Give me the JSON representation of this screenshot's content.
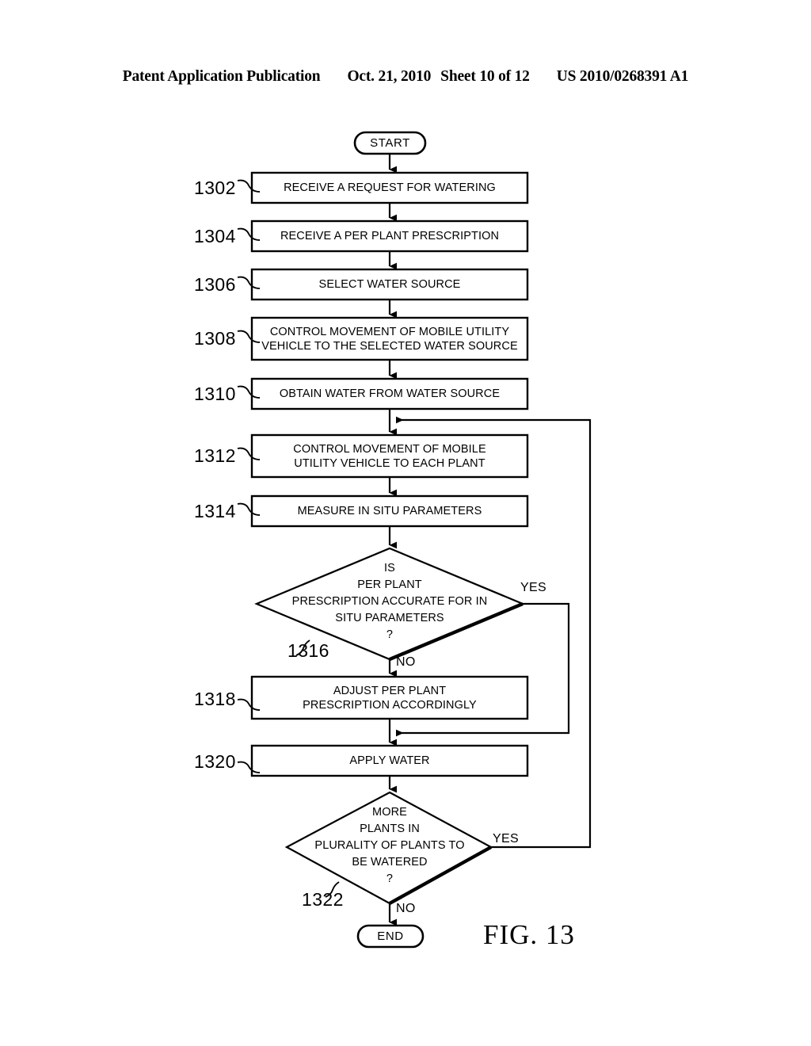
{
  "header": {
    "publication": "Patent Application Publication",
    "date": "Oct. 21, 2010",
    "sheet": "Sheet 10 of 12",
    "pub_number": "US 2010/0268391 A1"
  },
  "figure": {
    "caption": "FIG. 13"
  },
  "flowchart": {
    "start_label": "START",
    "end_label": "END",
    "steps": [
      {
        "ref": "1302",
        "lines": [
          "RECEIVE A REQUEST FOR WATERING"
        ]
      },
      {
        "ref": "1304",
        "lines": [
          "RECEIVE A PER PLANT PRESCRIPTION"
        ]
      },
      {
        "ref": "1306",
        "lines": [
          "SELECT WATER SOURCE"
        ]
      },
      {
        "ref": "1308",
        "lines": [
          "CONTROL MOVEMENT OF MOBILE UTILITY",
          "VEHICLE TO THE SELECTED WATER SOURCE"
        ]
      },
      {
        "ref": "1310",
        "lines": [
          "OBTAIN WATER FROM WATER SOURCE"
        ]
      },
      {
        "ref": "1312",
        "lines": [
          "CONTROL MOVEMENT OF MOBILE",
          "UTILITY VEHICLE TO EACH PLANT"
        ]
      },
      {
        "ref": "1314",
        "lines": [
          "MEASURE IN SITU PARAMETERS"
        ]
      },
      {
        "ref": "1318",
        "lines": [
          "ADJUST PER PLANT",
          "PRESCRIPTION ACCORDINGLY"
        ]
      },
      {
        "ref": "1320",
        "lines": [
          "APPLY WATER"
        ]
      }
    ],
    "decisions": [
      {
        "ref": "1316",
        "lines": [
          "IS",
          "PER PLANT",
          "PRESCRIPTION ACCURATE FOR IN",
          "SITU PARAMETERS",
          "?"
        ],
        "yes_label": "YES",
        "no_label": "NO"
      },
      {
        "ref": "1322",
        "lines": [
          "MORE",
          "PLANTS IN",
          "PLURALITY OF PLANTS TO",
          "BE WATERED",
          "?"
        ],
        "yes_label": "YES",
        "no_label": "NO"
      }
    ]
  },
  "colors": {
    "ink": "#000000",
    "paper": "#ffffff"
  }
}
